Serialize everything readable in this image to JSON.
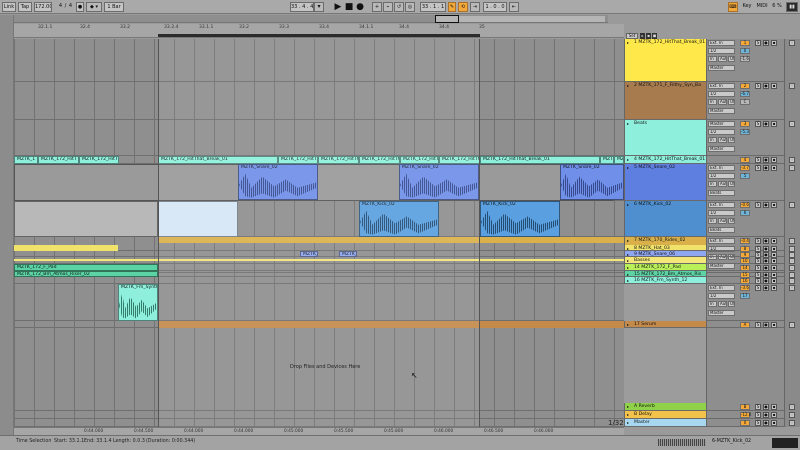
{
  "transport": {
    "link": "Link",
    "tap": "Tap",
    "tempo": "172.00",
    "sig_num": "4",
    "sig_den": "4",
    "dot_toggle": "●",
    "metro_icon": "metronome-icon",
    "quantize": "1 Bar",
    "position": "33 .  4 .  4",
    "play_glyph": "▶",
    "stop_glyph": "■",
    "record_glyph": "●",
    "loop_start": "33 .  1 .  1",
    "loop_length": "1 .  0 .  0",
    "key_label": "Key",
    "midi_label": "MIDI",
    "cpu": "6 %",
    "accent": "#f2a93a"
  },
  "ruler": {
    "bars": [
      "32.1.1",
      "32.4",
      "33.2",
      "33.3.4",
      "33.1.1",
      "33.2",
      "33.3",
      "33.4",
      "34.1.1",
      "34.4",
      "34.4",
      "35"
    ],
    "times": [
      "0:44.000",
      "0:44.500",
      "0:44.000",
      "0:44.000",
      "0:45.000",
      "0:45.500",
      "0:45.800",
      "0:46.000",
      "0:46.500",
      "0:46.000"
    ]
  },
  "arrangement": {
    "drop_text": "Drop Files and Devices Here",
    "pos_indicator": "1/32"
  },
  "clips": [
    {
      "lane": "lane3",
      "labels": [
        "MZTK_1",
        "MZTK_172_HitT",
        "MZTK_172_HitThat",
        "MZTK_172_HitThat_Break_01",
        "MZTK_172_HitThat",
        "MZTK_172_HitThat_Break_01",
        "MZTK_172_HitThat",
        "MZTK_172_HitThat_Break_01",
        "MZTK_172_HitThat",
        "MZTK_172_HitThat_Break_01",
        "MZTK_172_HitThat",
        "MZTK_172_HitThat_Break_01"
      ]
    },
    {
      "lane": "lane5",
      "labels": [
        "MZTK_Snare_02",
        "MZTK_Snare_02",
        "MZTK_Snare_02"
      ]
    },
    {
      "lane": "lane6",
      "labels": [
        "MZTK_Kick_02",
        "MZTK_Kick_02",
        "MZTK_Kick_02"
      ]
    },
    {
      "lane": "lane9",
      "labels": [
        "MZTK_SI",
        "MZTK_SI"
      ]
    },
    {
      "lane": "lane12",
      "labels": [
        "MZTK_172_F_Pad"
      ]
    },
    {
      "lane": "lane13",
      "labels": [
        "MZTK_172_Bm_Atmos_Riser_02"
      ]
    },
    {
      "lane": "lane14",
      "labels": [
        "MZTK_Fm_Synth_"
      ]
    }
  ],
  "tracks": [
    {
      "name": "1 MZTK_172_HitThat_Break_01",
      "color": "#ffe94a"
    },
    {
      "name": "2 MZTK_171_F_Filthy_Syn_Ba",
      "color": "#a77b4e"
    },
    {
      "name": "Beats",
      "color": "#8ef0dc"
    },
    {
      "name": "4 MZTK_172_HitThat_Break_01",
      "color": "#8ef0dc"
    },
    {
      "name": "5 MZTK_Snare_02",
      "color": "#5f7fe0"
    },
    {
      "name": "6 MZTK_Kick_02",
      "color": "#4f8fd0"
    },
    {
      "name": "7 MZTK_170_Rides_02",
      "color": "#d9b04a"
    },
    {
      "name": "8 MZTK_Hat_03",
      "color": "#f0e26a"
    },
    {
      "name": "9 MZTK_Snare_06",
      "color": "#8fa6f0"
    },
    {
      "name": "Basses",
      "color": "#f3e77a"
    },
    {
      "name": "14 MZTK_172_F_Pad",
      "color": "#b9f05a"
    },
    {
      "name": "15 MZTK_172_Bm_Atmos_Ris",
      "color": "#5cd3a4"
    },
    {
      "name": "16 MZTK_Fm_Synth_12",
      "color": "#8ef0dc"
    },
    {
      "name": "17 Serum",
      "color": "#c48a4a"
    },
    {
      "name": "A Reverb",
      "color": "#8fd24a"
    },
    {
      "name": "B Delay",
      "color": "#f2c24a"
    },
    {
      "name": "Master",
      "color": "#a8d8f0"
    }
  ],
  "mixer": {
    "ext_in": "Ext. In",
    "master": "Master",
    "beats": "Beats",
    "ii": "1/2",
    "in_label": "In",
    "auto_label": "Auto",
    "off_label": "Off",
    "vals": [
      "1",
      "0",
      "-1.6",
      "2",
      "-6.7",
      "C",
      "3",
      "-5.3",
      "4",
      "-3.7",
      "5",
      "-0.6",
      "6",
      "-0.4",
      "7",
      "8",
      "9",
      "10",
      "14",
      "15",
      "16",
      "-3.6",
      "17",
      "A",
      "B",
      "-12.0",
      "0"
    ]
  },
  "set_label": "Set",
  "status": {
    "mode": "Time Selection",
    "start": "Start: 33.1.1",
    "end": "End: 33.1.4",
    "length": "Length: 0.0.3",
    "duration": "(Duration: 0:00.344)",
    "track": "6-MZTK_Kick_02"
  }
}
